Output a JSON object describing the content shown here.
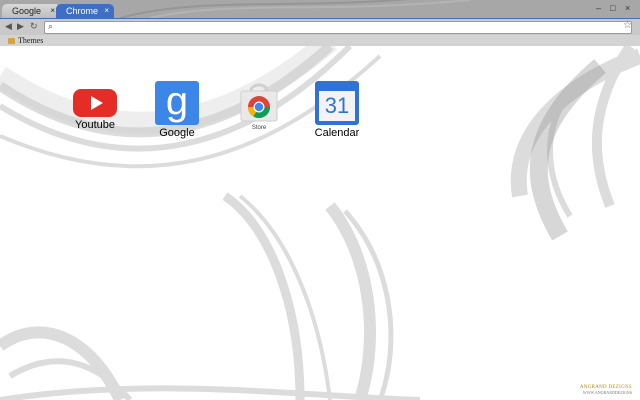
{
  "tabs": [
    {
      "label": "Google",
      "close": "×"
    },
    {
      "label": "Chrome",
      "close": "×"
    }
  ],
  "window_controls": {
    "minimize": "–",
    "maximize": "□",
    "close": "×"
  },
  "toolbar": {
    "back": "◀",
    "forward": "▶",
    "reload": "↻",
    "search_icon": "⌕",
    "star": "☆",
    "omnibox_value": ""
  },
  "bookmarks": [
    {
      "label": "Themes"
    }
  ],
  "apps": [
    {
      "label": "Youtube",
      "icon": "youtube-icon"
    },
    {
      "label": "Google",
      "icon": "google-icon",
      "glyph": "g"
    },
    {
      "label": "Store",
      "icon": "chrome-web-store-icon"
    },
    {
      "label": "Calendar",
      "icon": "calendar-icon",
      "glyph": "31"
    }
  ],
  "branding": {
    "line1": "ANGRAND DEZIGNS",
    "line2": "WWW.ANGRANDDEZIGNS"
  },
  "colors": {
    "accent": "#3f6fc4",
    "youtube_red": "#e52d27",
    "google_blue": "#3c86e8",
    "calendar_blue": "#2f73d9"
  }
}
